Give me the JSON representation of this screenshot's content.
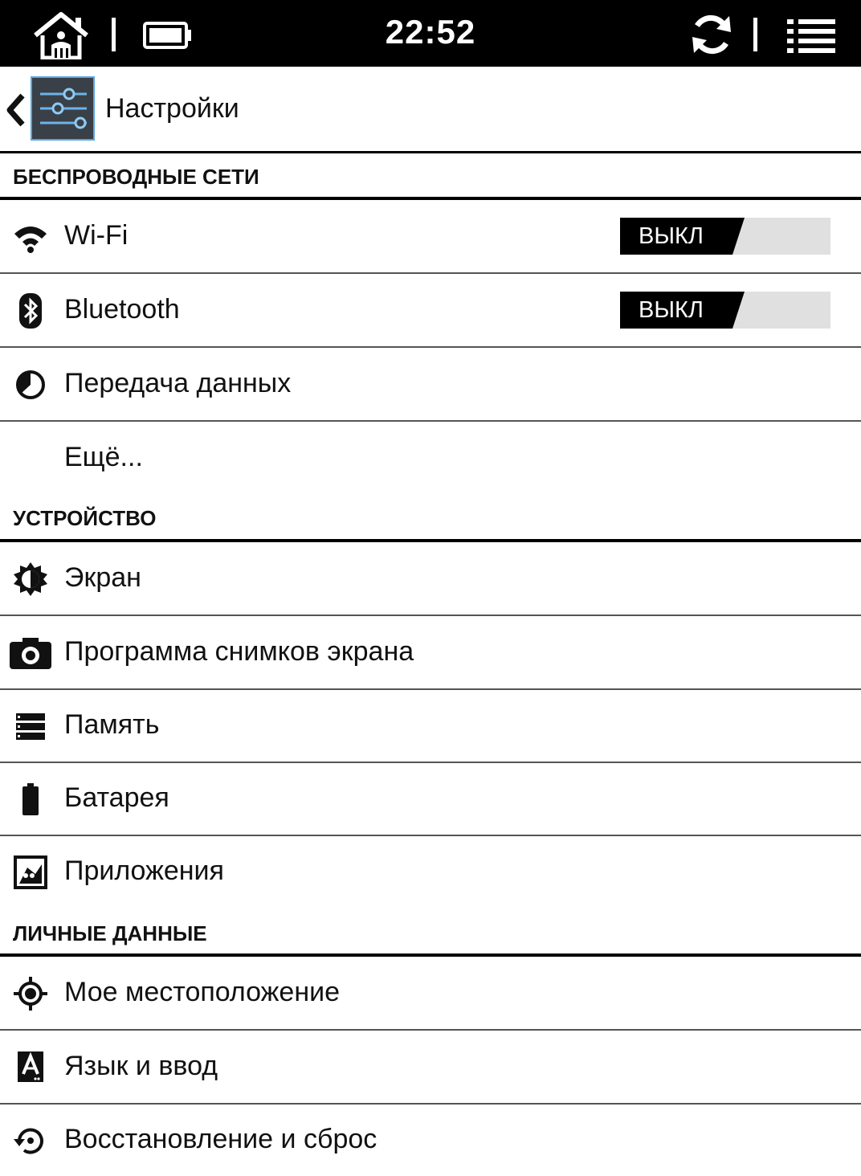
{
  "status_bar": {
    "time": "22:52",
    "icons": [
      "home-icon",
      "battery-icon",
      "sync-icon",
      "menu-icon"
    ]
  },
  "action_bar": {
    "title": "Настройки",
    "icons": [
      "back-chevron-icon",
      "settings-sliders-icon"
    ],
    "app_icon_color": "#3a87c8"
  },
  "sections": [
    {
      "header": "БЕСПРОВОДНЫЕ СЕТИ",
      "items": [
        {
          "label": "Wi-Fi",
          "icon": "wifi-icon",
          "toggle": "ВЫКЛ"
        },
        {
          "label": "Bluetooth",
          "icon": "bluetooth-icon",
          "toggle": "ВЫКЛ"
        },
        {
          "label": "Передача данных",
          "icon": "data-usage-icon"
        },
        {
          "label": "Ещё...",
          "icon": ""
        }
      ]
    },
    {
      "header": "УСТРОЙСТВО",
      "items": [
        {
          "label": "Экран",
          "icon": "brightness-icon"
        },
        {
          "label": "Программа снимков экрана",
          "icon": "camera-icon"
        },
        {
          "label": "Память",
          "icon": "storage-icon"
        },
        {
          "label": "Батарея",
          "icon": "battery-icon"
        },
        {
          "label": "Приложения",
          "icon": "apps-icon"
        }
      ]
    },
    {
      "header": "ЛИЧНЫЕ ДАННЫЕ",
      "items": [
        {
          "label": "Мое местоположение",
          "icon": "location-icon"
        },
        {
          "label": "Язык и ввод",
          "icon": "language-icon"
        },
        {
          "label": "Восстановление и сброс",
          "icon": "restore-icon"
        }
      ]
    }
  ],
  "colors": {
    "status_bar_bg": "#000000",
    "toggle_off_bg": "#000000",
    "toggle_track": "#e0e0e0"
  }
}
